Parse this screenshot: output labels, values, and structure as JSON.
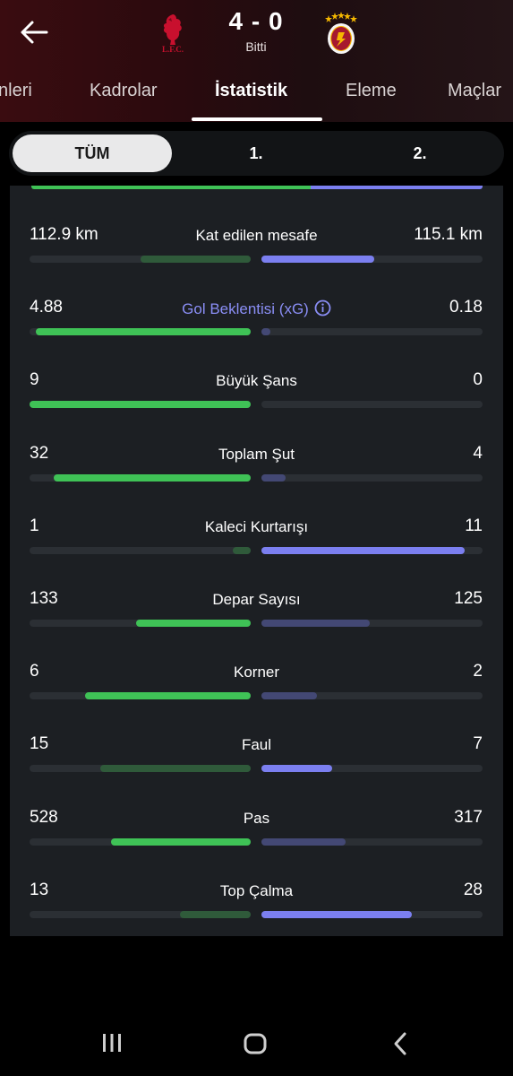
{
  "header": {
    "home_team": "Liverpool",
    "away_team": "Galatasaray",
    "home_crest_text": "L.F.C.",
    "score": "4 - 0",
    "status": "Bitti"
  },
  "tabs": [
    {
      "label": "nleri"
    },
    {
      "label": "Kadrolar"
    },
    {
      "label": "İstatistik",
      "active": true
    },
    {
      "label": "Eleme"
    },
    {
      "label": "Maçlar"
    }
  ],
  "periods": [
    {
      "label": "TÜM",
      "active": true
    },
    {
      "label": "1."
    },
    {
      "label": "2."
    }
  ],
  "colors": {
    "home_strong": "#3fc256",
    "home_weak": "#2f5a3a",
    "away_strong": "#7b7ff0",
    "away_weak": "#434874",
    "xg_label": "#8a8ef5"
  },
  "stats": [
    {
      "label": "Kat edilen mesafe",
      "left": "112.9 km",
      "right": "115.1 km",
      "left_fill": 0.5,
      "right_fill": 0.51,
      "left_strong": false,
      "right_strong": true
    },
    {
      "label": "Gol Beklentisi (xG)",
      "left": "4.88",
      "right": "0.18",
      "left_fill": 0.97,
      "right_fill": 0.04,
      "left_strong": true,
      "right_strong": false,
      "info": true
    },
    {
      "label": "Büyük Şans",
      "left": "9",
      "right": "0",
      "left_fill": 1.0,
      "right_fill": 0.0,
      "left_strong": true,
      "right_strong": false
    },
    {
      "label": "Toplam Şut",
      "left": "32",
      "right": "4",
      "left_fill": 0.89,
      "right_fill": 0.11,
      "left_strong": true,
      "right_strong": false
    },
    {
      "label": "Kaleci Kurtarışı",
      "left": "1",
      "right": "11",
      "left_fill": 0.08,
      "right_fill": 0.92,
      "left_strong": false,
      "right_strong": true
    },
    {
      "label": "Depar Sayısı",
      "left": "133",
      "right": "125",
      "left_fill": 0.52,
      "right_fill": 0.49,
      "left_strong": true,
      "right_strong": false
    },
    {
      "label": "Korner",
      "left": "6",
      "right": "2",
      "left_fill": 0.75,
      "right_fill": 0.25,
      "left_strong": true,
      "right_strong": false
    },
    {
      "label": "Faul",
      "left": "15",
      "right": "7",
      "left_fill": 0.68,
      "right_fill": 0.32,
      "left_strong": false,
      "right_strong": true
    },
    {
      "label": "Pas",
      "left": "528",
      "right": "317",
      "left_fill": 0.63,
      "right_fill": 0.38,
      "left_strong": true,
      "right_strong": false
    },
    {
      "label": "Top Çalma",
      "left": "13",
      "right": "28",
      "left_fill": 0.32,
      "right_fill": 0.68,
      "left_strong": false,
      "right_strong": true
    }
  ],
  "possession_strip": {
    "home": 0.62,
    "away": 0.38
  }
}
